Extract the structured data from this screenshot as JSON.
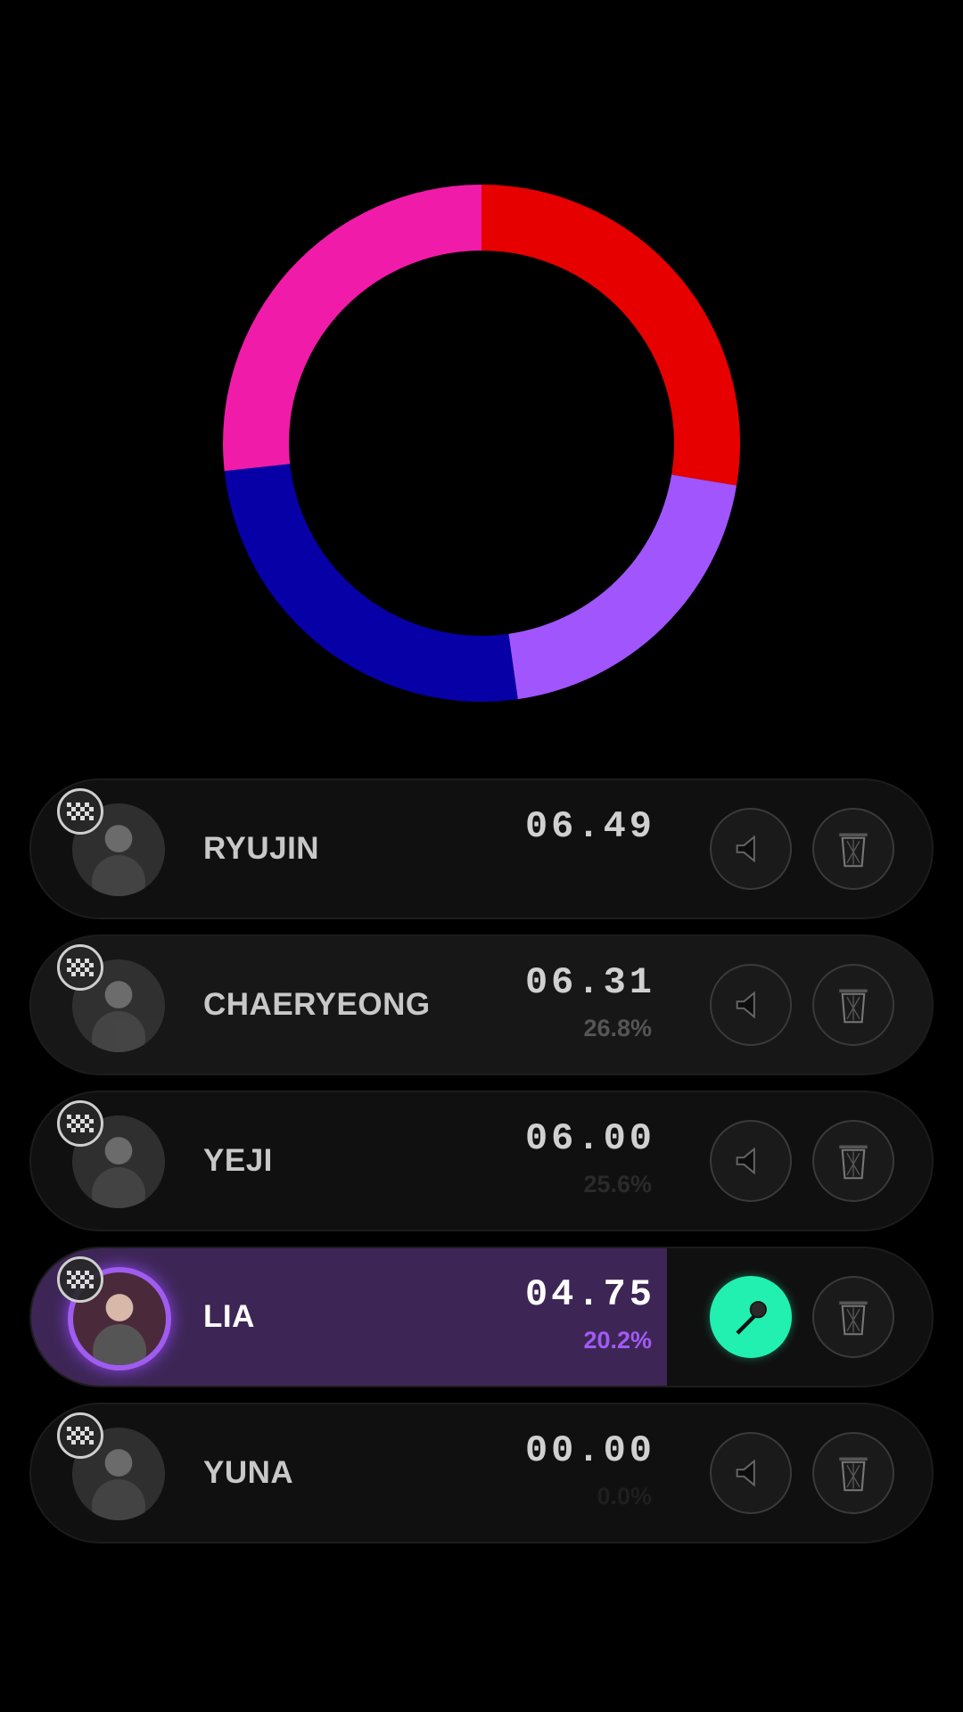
{
  "chart_data": {
    "type": "pie",
    "title": "",
    "segments": [
      {
        "color": "#e60000",
        "value": 27.7
      },
      {
        "color": "#a155fc",
        "value": 20.2
      },
      {
        "color": "#0700a6",
        "value": 25.6
      },
      {
        "color": "#f01ba8",
        "value": 26.8
      }
    ]
  },
  "members": [
    {
      "name": "RYUJIN",
      "time": "06.49",
      "percent": "",
      "active": false
    },
    {
      "name": "CHAERYEONG",
      "time": "06.31",
      "percent": "26.8%",
      "active": false
    },
    {
      "name": "YEJI",
      "time": "06.00",
      "percent": "25.6%",
      "active": false
    },
    {
      "name": "LIA",
      "time": "04.75",
      "percent": "20.2%",
      "active": true
    },
    {
      "name": "YUNA",
      "time": "00.00",
      "percent": "0.0%",
      "active": false
    }
  ],
  "lia_progress": 0.706,
  "icons": {
    "badge": "checkered-flag-icon",
    "speaker": "speaker-icon",
    "mic": "microphone-icon",
    "trash": "trash-icon"
  },
  "colors": {
    "active_row": "#3d2656",
    "active_ring": "#a05cf0",
    "mic_active": "#21f0b0",
    "percent_active": "#a25af4"
  }
}
